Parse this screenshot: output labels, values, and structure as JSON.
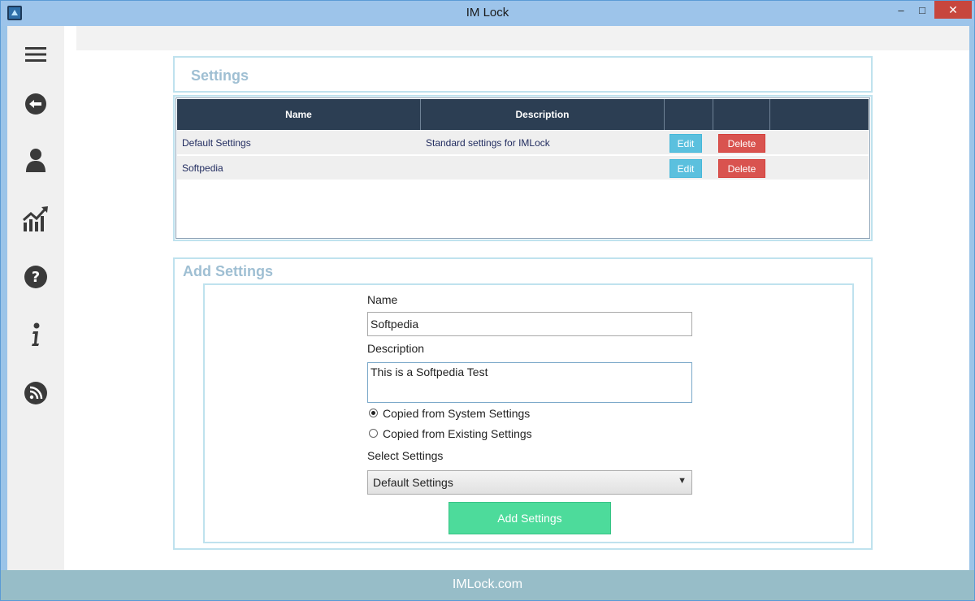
{
  "window": {
    "title": "IM Lock",
    "min_glyph": "–",
    "max_glyph": "□",
    "close_glyph": "✕"
  },
  "sidebar": {
    "items": [
      {
        "icon": "menu-icon"
      },
      {
        "icon": "back-arrow-icon"
      },
      {
        "icon": "user-icon"
      },
      {
        "icon": "chart-icon"
      },
      {
        "icon": "help-icon"
      },
      {
        "icon": "info-icon"
      },
      {
        "icon": "rss-icon"
      }
    ]
  },
  "settings": {
    "title": "Settings",
    "columns": [
      "Name",
      "Description",
      "",
      "",
      ""
    ],
    "rows": [
      {
        "name": "Default Settings",
        "description": "Standard settings for IMLock",
        "edit_label": "Edit",
        "delete_label": "Delete"
      },
      {
        "name": "Softpedia",
        "description": "",
        "edit_label": "Edit",
        "delete_label": "Delete"
      }
    ]
  },
  "add_settings": {
    "title": "Add Settings",
    "name_label": "Name",
    "name_value": "Softpedia",
    "description_label": "Description",
    "description_value": "This is a Softpedia Test",
    "radio_system": "Copied from System Settings",
    "radio_existing": "Copied from Existing Settings",
    "radio_selected": "system",
    "select_label": "Select Settings",
    "select_value": "Default Settings",
    "submit_label": "Add Settings"
  },
  "footer": {
    "text": "IMLock.com"
  },
  "colors": {
    "header_dark": "#2c3e53",
    "edit_button": "#5bc0de",
    "delete_button": "#d9534f",
    "add_button": "#4ddb9b",
    "footer": "#97bdc8"
  }
}
